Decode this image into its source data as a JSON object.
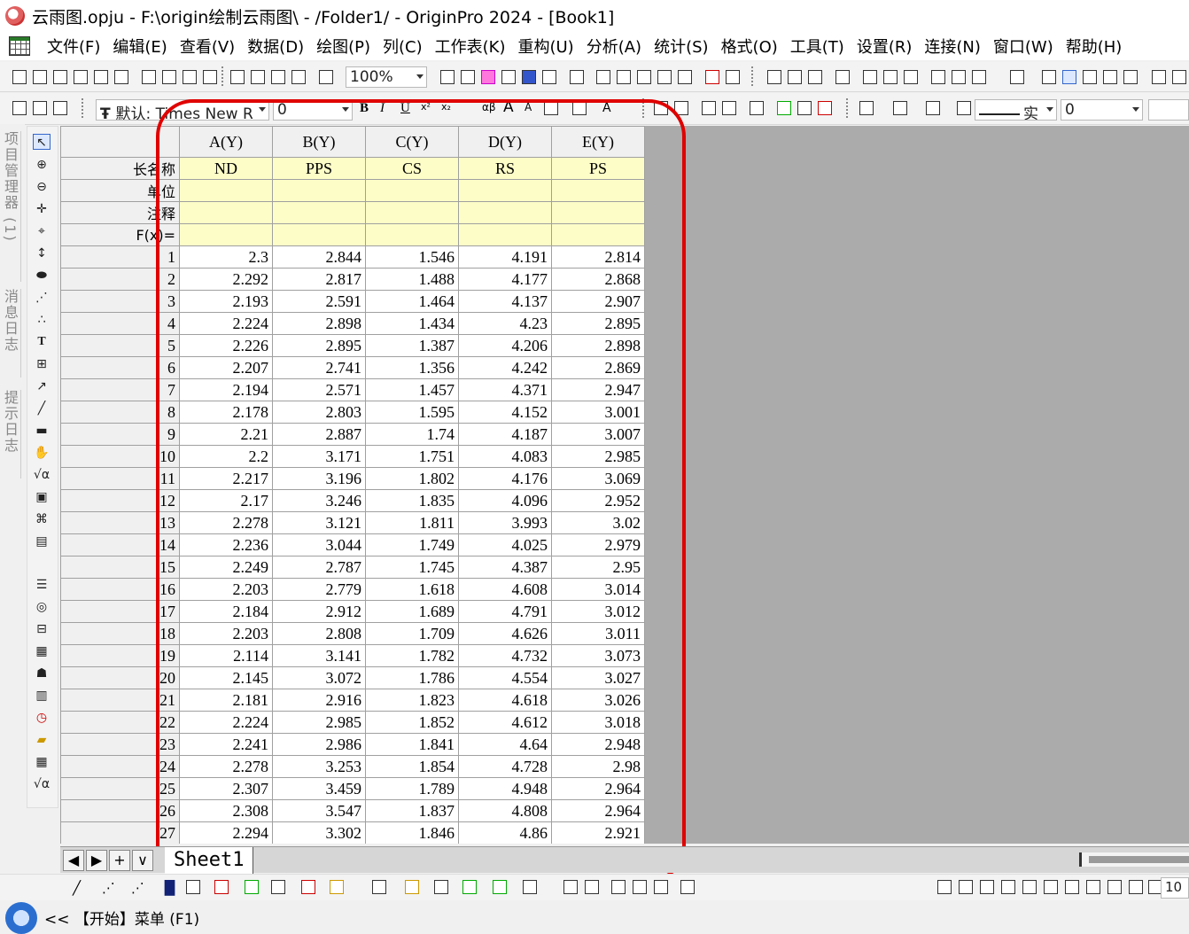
{
  "window": {
    "title": "云雨图.opju - F:\\origin绘制云雨图\\ - /Folder1/ - OriginPro 2024 - [Book1]"
  },
  "menu": [
    "文件(F)",
    "编辑(E)",
    "查看(V)",
    "数据(D)",
    "绘图(P)",
    "列(C)",
    "工作表(K)",
    "重构(U)",
    "分析(A)",
    "统计(S)",
    "格式(O)",
    "工具(T)",
    "设置(R)",
    "连接(N)",
    "窗口(W)",
    "帮助(H)"
  ],
  "toolbar": {
    "zoom": "100%",
    "font": "默认: Times New R",
    "font_size": "0",
    "line_style": "实",
    "line_width": "0",
    "right_value": "10"
  },
  "left_tabs": [
    "项目管理器 (1)",
    "消息日志",
    "提示日志"
  ],
  "columns": [
    {
      "header": "A(Y)",
      "long_name": "ND"
    },
    {
      "header": "B(Y)",
      "long_name": "PPS"
    },
    {
      "header": "C(Y)",
      "long_name": "CS"
    },
    {
      "header": "D(Y)",
      "long_name": "RS"
    },
    {
      "header": "E(Y)",
      "long_name": "PS"
    }
  ],
  "row_labels": [
    "长名称",
    "单位",
    "注释",
    "F(x)="
  ],
  "rows": [
    [
      "2.3",
      "2.844",
      "1.546",
      "4.191",
      "2.814"
    ],
    [
      "2.292",
      "2.817",
      "1.488",
      "4.177",
      "2.868"
    ],
    [
      "2.193",
      "2.591",
      "1.464",
      "4.137",
      "2.907"
    ],
    [
      "2.224",
      "2.898",
      "1.434",
      "4.23",
      "2.895"
    ],
    [
      "2.226",
      "2.895",
      "1.387",
      "4.206",
      "2.898"
    ],
    [
      "2.207",
      "2.741",
      "1.356",
      "4.242",
      "2.869"
    ],
    [
      "2.194",
      "2.571",
      "1.457",
      "4.371",
      "2.947"
    ],
    [
      "2.178",
      "2.803",
      "1.595",
      "4.152",
      "3.001"
    ],
    [
      "2.21",
      "2.887",
      "1.74",
      "4.187",
      "3.007"
    ],
    [
      "2.2",
      "3.171",
      "1.751",
      "4.083",
      "2.985"
    ],
    [
      "2.217",
      "3.196",
      "1.802",
      "4.176",
      "3.069"
    ],
    [
      "2.17",
      "3.246",
      "1.835",
      "4.096",
      "2.952"
    ],
    [
      "2.278",
      "3.121",
      "1.811",
      "3.993",
      "3.02"
    ],
    [
      "2.236",
      "3.044",
      "1.749",
      "4.025",
      "2.979"
    ],
    [
      "2.249",
      "2.787",
      "1.745",
      "4.387",
      "2.95"
    ],
    [
      "2.203",
      "2.779",
      "1.618",
      "4.608",
      "3.014"
    ],
    [
      "2.184",
      "2.912",
      "1.689",
      "4.791",
      "3.012"
    ],
    [
      "2.203",
      "2.808",
      "1.709",
      "4.626",
      "3.011"
    ],
    [
      "2.114",
      "3.141",
      "1.782",
      "4.732",
      "3.073"
    ],
    [
      "2.145",
      "3.072",
      "1.786",
      "4.554",
      "3.027"
    ],
    [
      "2.181",
      "2.916",
      "1.823",
      "4.618",
      "3.026"
    ],
    [
      "2.224",
      "2.985",
      "1.852",
      "4.612",
      "3.018"
    ],
    [
      "2.241",
      "2.986",
      "1.841",
      "4.64",
      "2.948"
    ],
    [
      "2.278",
      "3.253",
      "1.854",
      "4.728",
      "2.98"
    ],
    [
      "2.307",
      "3.459",
      "1.789",
      "4.948",
      "2.964"
    ],
    [
      "2.308",
      "3.547",
      "1.837",
      "4.808",
      "2.964"
    ],
    [
      "2.294",
      "3.302",
      "1.846",
      "4.86",
      "2.921"
    ]
  ],
  "sheet_tab": "Sheet1",
  "status": "<< 【开始】菜单 (F1)",
  "colors": {
    "highlight": "#e00000",
    "meta_row": "#fdfdc8"
  }
}
